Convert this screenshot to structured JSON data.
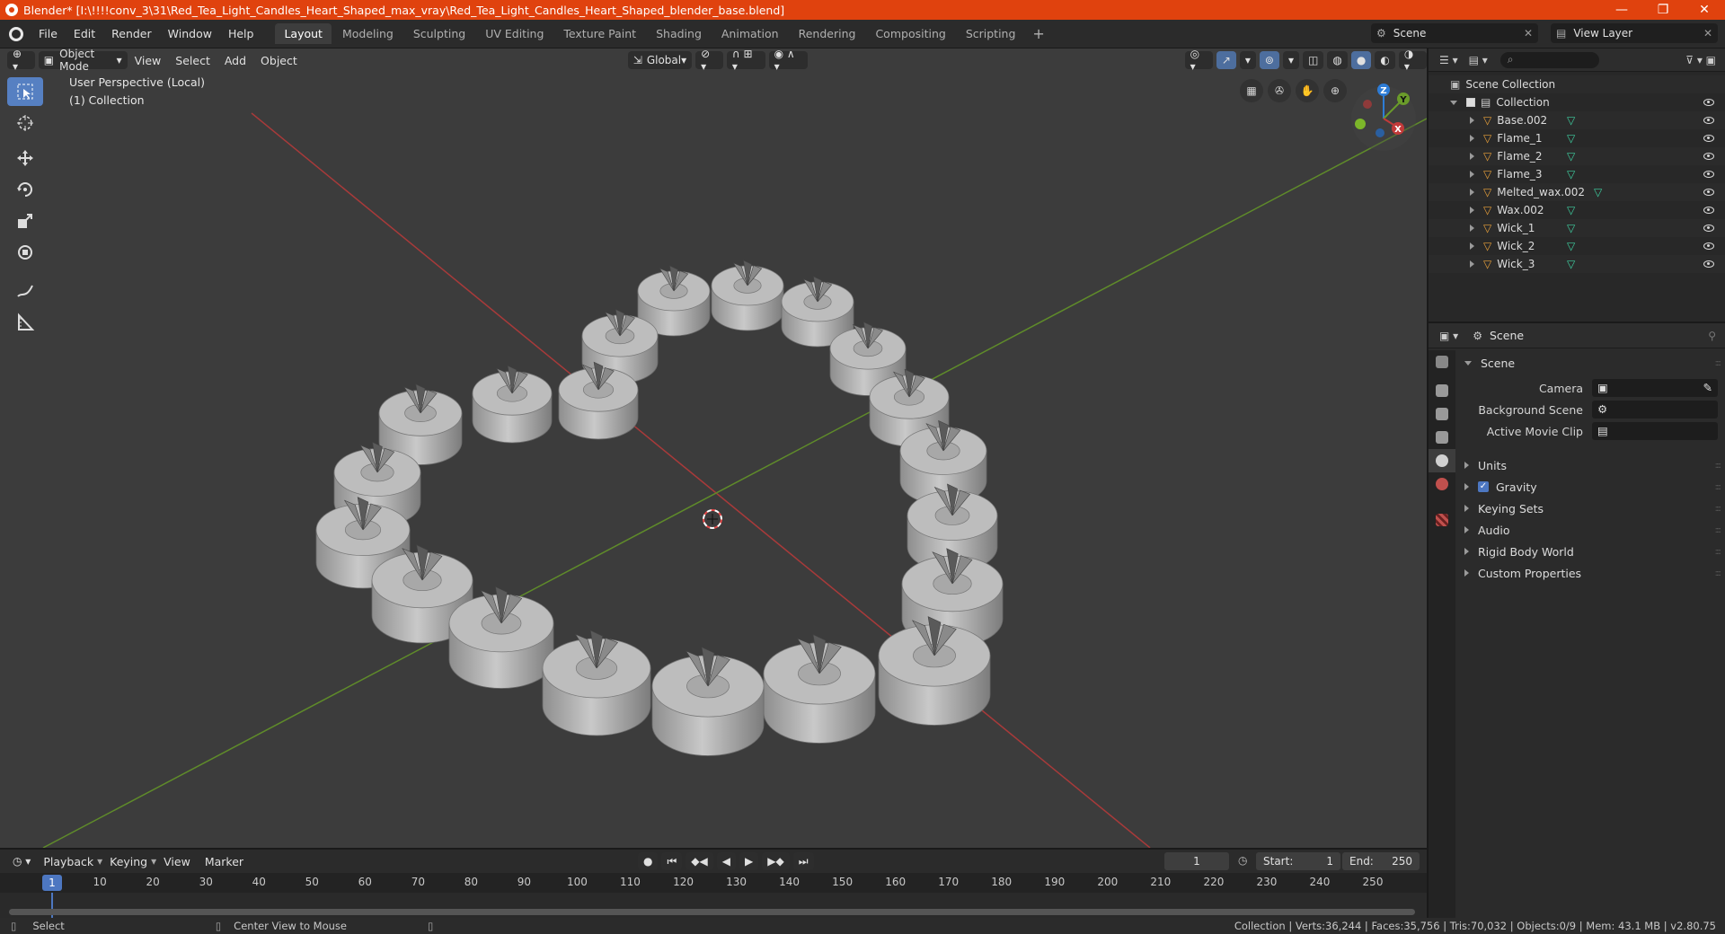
{
  "window": {
    "title": "Blender* [I:\\!!!!conv_3\\31\\Red_Tea_Light_Candles_Heart_Shaped_max_vray\\Red_Tea_Light_Candles_Heart_Shaped_blender_base.blend]",
    "minimize": "—",
    "maximize": "❐",
    "close": "✕"
  },
  "menu": {
    "items": [
      "File",
      "Edit",
      "Render",
      "Window",
      "Help"
    ],
    "workspaces": [
      "Layout",
      "Modeling",
      "Sculpting",
      "UV Editing",
      "Texture Paint",
      "Shading",
      "Animation",
      "Rendering",
      "Compositing",
      "Scripting"
    ],
    "active_workspace": "Layout",
    "add_tab": "+",
    "scene": "Scene",
    "view_layer": "View Layer"
  },
  "viewport": {
    "mode": "Object Mode",
    "menus": [
      "View",
      "Select",
      "Add",
      "Object"
    ],
    "orientation": "Global",
    "overlay_line1": "User Perspective (Local)",
    "overlay_line2": "(1) Collection",
    "gizmo": {
      "z": "Z",
      "y": "Y",
      "x": "X"
    },
    "colors": {
      "x_axis": "#c23a3a",
      "y_axis": "#6a9b2a",
      "background": "#3c3c3c",
      "grid": "#464646"
    }
  },
  "outliner": {
    "root": "Scene Collection",
    "collection": "Collection",
    "objects": [
      "Base.002",
      "Flame_1",
      "Flame_2",
      "Flame_3",
      "Melted_wax.002",
      "Wax.002",
      "Wick_1",
      "Wick_2",
      "Wick_3"
    ]
  },
  "properties": {
    "header": "Scene",
    "panel_title": "Scene",
    "fields": {
      "camera": "Camera",
      "background_scene": "Background Scene",
      "active_movie_clip": "Active Movie Clip"
    },
    "subpanels": [
      "Units",
      "Gravity",
      "Keying Sets",
      "Audio",
      "Rigid Body World",
      "Custom Properties"
    ],
    "gravity_checked": true
  },
  "timeline": {
    "menus": [
      "Playback",
      "Keying",
      "View",
      "Marker"
    ],
    "current_frame": "1",
    "start_label": "Start:",
    "start": "1",
    "end_label": "End:",
    "end": "250",
    "ruler_marks": [
      "10",
      "20",
      "30",
      "40",
      "50",
      "60",
      "70",
      "80",
      "90",
      "100",
      "110",
      "120",
      "130",
      "140",
      "150",
      "160",
      "170",
      "180",
      "190",
      "200",
      "210",
      "220",
      "230",
      "240",
      "250"
    ],
    "ruler_current": "1"
  },
  "status": {
    "left_action": "Select",
    "middle_action": "Center View to Mouse",
    "stats": "Collection | Verts:36,244 | Faces:35,756 | Tris:70,032 | Objects:0/9 | Mem: 43.1 MB | v2.80.75"
  }
}
